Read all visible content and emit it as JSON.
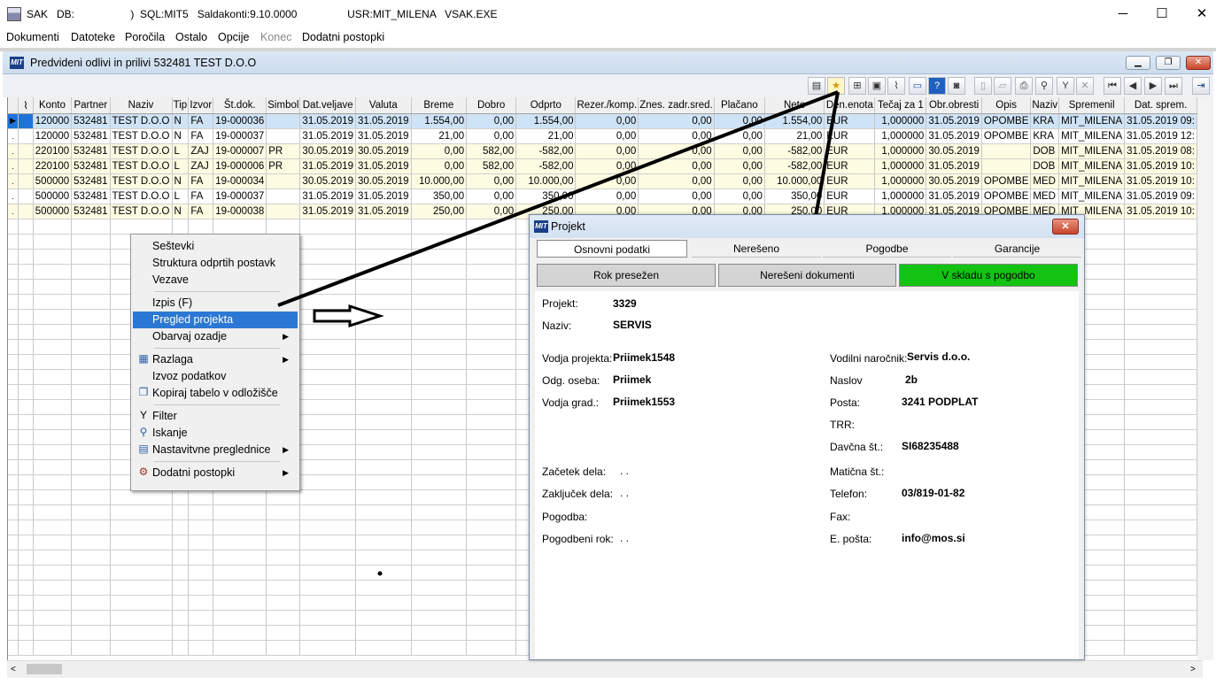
{
  "window": {
    "title": "SAK   DB:                   )  SQL:MIT5   Saldakonti:9.10.0000                 USR:MIT_MILENA   VSAK.EXE",
    "minimize": "─",
    "maximize": "☐",
    "close": "✕"
  },
  "menu": [
    "Dokumenti",
    "Datoteke",
    "Poročila",
    "Ostalo",
    "Opcije",
    "Konec",
    "Dodatni postopki"
  ],
  "child": {
    "logo": "MIT",
    "title": "Predvideni odlivi in prilivi   532481 TEST D.O.O",
    "btn_min": "▁",
    "btn_restore": "❐",
    "btn_close": "✕"
  },
  "grid": {
    "columns": [
      "",
      "",
      "Konto",
      "Partner",
      "Naziv",
      "Tip",
      "Izvor",
      "Št.dok.",
      "Simbol",
      "Dat.veljave",
      "Valuta",
      "Breme",
      "Dobro",
      "Odprto",
      "Rezer./komp.",
      "Znes. zadr.sred.",
      "Plačano",
      "Neto",
      "Den.enota",
      "Tečaj za 1",
      "Obr.obresti",
      "Opis",
      "Naziv",
      "Spremenil",
      "Dat. sprem."
    ],
    "rows": [
      [
        "▶",
        "",
        "120000",
        "532481",
        "TEST D.O.O",
        "N",
        "FA",
        "19-000036",
        "",
        "31.05.2019",
        "31.05.2019",
        "1.554,00",
        "0,00",
        "1.554,00",
        "0,00",
        "0,00",
        "0,00",
        "1.554,00",
        "EUR",
        "1,000000",
        "31.05.2019",
        "OPOMBE",
        "KRA",
        "MIT_MILENA",
        "31.05.2019 09:"
      ],
      [
        ".",
        "",
        "120000",
        "532481",
        "TEST D.O.O",
        "N",
        "FA",
        "19-000037",
        "",
        "31.05.2019",
        "31.05.2019",
        "21,00",
        "0,00",
        "21,00",
        "0,00",
        "0,00",
        "0,00",
        "21,00",
        "EUR",
        "1,000000",
        "31.05.2019",
        "OPOMBE",
        "KRA",
        "MIT_MILENA",
        "31.05.2019 12:"
      ],
      [
        ".",
        "",
        "220100",
        "532481",
        "TEST D.O.O",
        "L",
        "ZAJ",
        "19-000007",
        "PR",
        "30.05.2019",
        "30.05.2019",
        "0,00",
        "582,00",
        "-582,00",
        "0,00",
        "0,00",
        "0,00",
        "-582,00",
        "EUR",
        "1,000000",
        "30.05.2019",
        "",
        "DOB",
        "MIT_MILENA",
        "31.05.2019 08:"
      ],
      [
        ".",
        "",
        "220100",
        "532481",
        "TEST D.O.O",
        "L",
        "ZAJ",
        "19-000006",
        "PR",
        "31.05.2019",
        "31.05.2019",
        "0,00",
        "582,00",
        "-582,00",
        "0,00",
        "0,00",
        "0,00",
        "-582,00",
        "EUR",
        "1,000000",
        "31.05.2019",
        "",
        "DOB",
        "MIT_MILENA",
        "31.05.2019 10:"
      ],
      [
        ".",
        "",
        "500000",
        "532481",
        "TEST D.O.O",
        "N",
        "FA",
        "19-000034",
        "",
        "30.05.2019",
        "30.05.2019",
        "10.000,00",
        "0,00",
        "10.000,00",
        "0,00",
        "0,00",
        "0,00",
        "10.000,00",
        "EUR",
        "1,000000",
        "30.05.2019",
        "OPOMBE",
        "MED",
        "MIT_MILENA",
        "31.05.2019 10:"
      ],
      [
        ".",
        "",
        "500000",
        "532481",
        "TEST D.O.O",
        "L",
        "FA",
        "19-000037",
        "",
        "31.05.2019",
        "31.05.2019",
        "350,00",
        "0,00",
        "350,00",
        "0,00",
        "0,00",
        "0,00",
        "350,00",
        "EUR",
        "1,000000",
        "31.05.2019",
        "OPOMBE",
        "MED",
        "MIT_MILENA",
        "31.05.2019 09:"
      ],
      [
        ".",
        "",
        "500000",
        "532481",
        "TEST D.O.O",
        "N",
        "FA",
        "19-000038",
        "",
        "31.05.2019",
        "31.05.2019",
        "250,00",
        "0,00",
        "250,00",
        "0,00",
        "0,00",
        "0,00",
        "250,00",
        "EUR",
        "1,000000",
        "31.05.2019",
        "OPOMBE",
        "MED",
        "MIT_MILENA",
        "31.05.2019 10:"
      ]
    ]
  },
  "context_menu": {
    "sestevki": "Seštevki",
    "struktura": "Struktura odprtih postavk",
    "vezave": "Vezave",
    "izpis": "Izpis (F)",
    "pregled": "Pregled projekta",
    "obarvaj": "Obarvaj ozadje",
    "razlaga": "Razlaga",
    "izvoz": "Izvoz podatkov",
    "kopiraj": "Kopiraj tabelo v odložišče",
    "filter": "Filter",
    "iskanje": "Iskanje",
    "nastavitve": "Nastavitvne preglednice",
    "dodatni": "Dodatni postopki"
  },
  "dialog": {
    "logo": "MIT",
    "title": "Projekt",
    "tabs": [
      "Osnovni podatki",
      "Nerešeno",
      "Pogodbe",
      "Garancije"
    ],
    "buttons": {
      "rok": "Rok presežen",
      "neres": "Nerešeni dokumenti",
      "sklad": "V skladu s pogodbo"
    },
    "left": {
      "projekt_l": "Projekt:",
      "projekt_v": "3329",
      "naziv_l": "Naziv:",
      "naziv_v": "SERVIS",
      "vodja_l": "Vodja projekta:",
      "vodja_v": "Priimek1548",
      "odg_l": "Odg. oseba:",
      "odg_v": "Priimek",
      "grad_l": "Vodja grad.:",
      "grad_v": "Priimek1553",
      "zacetek_l": "Začetek dela:",
      "zacetek_v": ". .",
      "zakljucek_l": "Zaključek dela:",
      "zakljucek_v": ". .",
      "pogodba_l": "Pogodba:",
      "rok_l": "Pogodbeni rok:",
      "rok_v": ". ."
    },
    "right": {
      "narocnik_l": "Vodilni naročnik:",
      "narocnik_v": "Servis d.o.o.",
      "naslov_l": "Naslov",
      "naslov_v": "2b",
      "posta_l": "Posta:",
      "posta_v": "3241 PODPLAT",
      "trr_l": "TRR:",
      "davcna_l": "Davčna št.:",
      "davcna_v": "SI68235488",
      "maticna_l": "Matična št.:",
      "telefon_l": "Telefon:",
      "telefon_v": "03/819-01-82",
      "fax_l": "Fax:",
      "eposta_l": "E. pošta:",
      "eposta_v": "info@mos.si"
    }
  },
  "colors": {
    "selected_row": "#cfe3f6",
    "highlight": "#2b78d4",
    "green_button": "#12c312",
    "gray_button": "#d4d4d4"
  }
}
